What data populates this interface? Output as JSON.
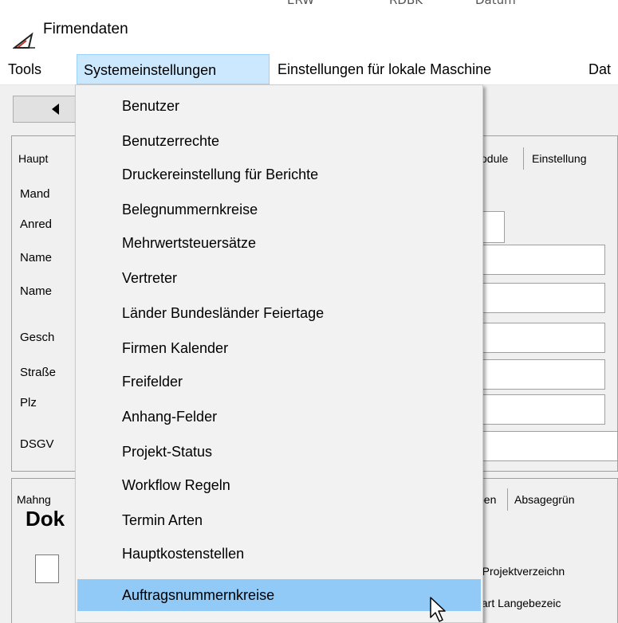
{
  "background_window": {
    "strip_texts": [
      "ERW",
      "RDBK",
      "Datum"
    ]
  },
  "window": {
    "title": "Firmendaten",
    "icon": "app-logo-icon"
  },
  "menubar": {
    "items": [
      {
        "label": "Tools"
      },
      {
        "label": "Systemeinstellungen"
      },
      {
        "label": "Einstellungen für lokale Maschine"
      },
      {
        "label": "Dat"
      }
    ]
  },
  "toolbar": {
    "back_icon": "triangle-left-icon"
  },
  "main_panel": {
    "tabs": [
      {
        "label": "Haupt"
      },
      {
        "label": "odule"
      },
      {
        "label": "Einstellung"
      }
    ],
    "labels": [
      {
        "text": "Mand"
      },
      {
        "text": "Anred"
      },
      {
        "text": "Name"
      },
      {
        "text": "Name"
      },
      {
        "text": "Gesch"
      },
      {
        "text": "Straße"
      },
      {
        "text": "Plz"
      },
      {
        "text": "DSGV"
      }
    ]
  },
  "lower_panel": {
    "tabs": [
      {
        "label": "Mahng"
      },
      {
        "label": "pen"
      },
      {
        "label": "Absagegrün"
      }
    ],
    "heading": "Dok",
    "right_texts": [
      {
        "text": "e Projektverzeichn"
      },
      {
        "text": "ktart Langebezeic"
      }
    ]
  },
  "dropdown": {
    "items": [
      {
        "label": "Benutzer"
      },
      {
        "label": "Benutzerrechte"
      },
      {
        "label": "Druckereinstellung für Berichte"
      },
      {
        "label": "Belegnummernkreise"
      },
      {
        "label": "Mehrwertsteuersätze"
      },
      {
        "label": "Vertreter"
      },
      {
        "label": "Länder Bundesländer Feiertage"
      },
      {
        "label": "Firmen Kalender"
      },
      {
        "label": "Freifelder"
      },
      {
        "label": "Anhang-Felder"
      },
      {
        "label": "Projekt-Status"
      },
      {
        "label": "Workflow Regeln"
      },
      {
        "label": "Termin Arten"
      },
      {
        "label": "Hauptkostenstellen"
      },
      {
        "label": "Auftragsnummernkreise"
      }
    ],
    "highlighted": "Auftragsnummernkreise"
  },
  "colors": {
    "menu_active_bg": "#cce8ff",
    "menu_active_border": "#99d1ff",
    "dropdown_highlight": "#91c9f7"
  }
}
